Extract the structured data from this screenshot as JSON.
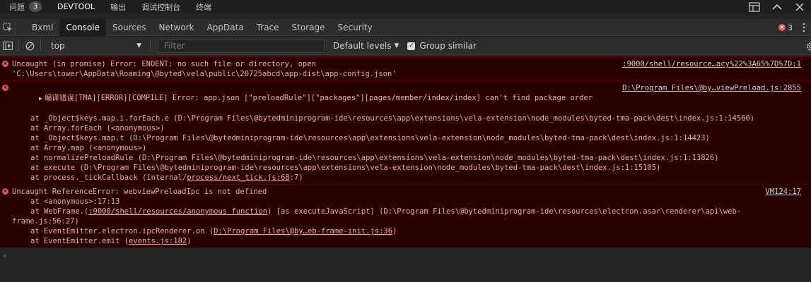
{
  "panel": {
    "tabs": [
      {
        "label": "问题",
        "badge": "3"
      },
      {
        "label": "DEVTOOL"
      },
      {
        "label": "输出"
      },
      {
        "label": "调试控制台"
      },
      {
        "label": "终端"
      }
    ],
    "icons": [
      "layout-panel-icon",
      "chevron-up-icon",
      "close-icon"
    ]
  },
  "devtools": {
    "tabs": [
      "Bxml",
      "Console",
      "Sources",
      "Network",
      "AppData",
      "Trace",
      "Storage",
      "Security"
    ],
    "active_tab": "Console",
    "error_count": "3"
  },
  "toolbar": {
    "context": "top",
    "filter_placeholder": "Filter",
    "levels": "Default levels",
    "group_similar": "Group similar",
    "group_similar_checked": true
  },
  "messages": [
    {
      "lines": [
        "Uncaught (in promise) Error: ENOENT: no such file or directory, open",
        "'C:\\Users\\tower\\AppData\\Roaming\\@byted\\vela\\public\\20725abcd\\app-dist\\app-config.json'"
      ],
      "source": ":9000/shell/resource…acy%22%3A65%7D%7D:1"
    },
    {
      "prefix": "编译错误",
      "head": "[TMA][ERROR][COMPILE] Error: app.json [\"preloadRule\"][\"packages\"][pages/member/index/index] can't find package order",
      "source": "D:\\Program Files\\@by…viewPreload.js:2855",
      "stack": [
        "at _Object$keys.map.i.forEach.e (D:\\Program Files\\@bytedminiprogram-ide\\resources\\app\\extensions\\vela-extension\\node_modules\\byted-tma-pack\\dest\\index.js:1:14560)",
        "at Array.forEach (<anonymous>)",
        "at _Object$keys.map.t (D:\\Program Files\\@bytedminiprogram-ide\\resources\\app\\extensions\\vela-extension\\node_modules\\byted-tma-pack\\dest\\index.js:1:14423)",
        "at Array.map (<anonymous>)",
        "at normalizePreloadRule (D:\\Program Files\\@bytedminiprogram-ide\\resources\\app\\extensions\\vela-extension\\node_modules\\byted-tma-pack\\dest\\index.js:1:13826)",
        "at execute (D:\\Program Files\\@bytedminiprogram-ide\\resources\\app\\extensions\\vela-extension\\node_modules\\byted-tma-pack\\dest\\index.js:1:15105)"
      ],
      "last_pre": "at process._tickCallback (internal/",
      "last_link": "process/next_tick.js:68",
      "last_post": ":7)"
    },
    {
      "head": "Uncaught ReferenceError: webviewPreloadIpc is not defined",
      "source": "VM124:17",
      "anon": "at <anonymous>:17:13",
      "webframe_pre": "at WebFrame.(",
      "webframe_link": ":9000/shell/resources/anonymous function",
      "webframe_post": ") [as executeJavaScript] (D:\\Program Files\\@bytedminiprogram-ide\\resources\\electron.asar\\renderer\\api\\web-",
      "webframe_wrap": "frame.js:56:27)",
      "emitter_pre": "at EventEmitter.electron.ipcRenderer.on (",
      "emitter_link": "D:\\Program Files\\@by…eb-frame-init.js:36",
      "emitter_post": ")",
      "emit_pre": "at EventEmitter.emit (",
      "emit_link": "events.js:182",
      "emit_post": ")"
    }
  ]
}
